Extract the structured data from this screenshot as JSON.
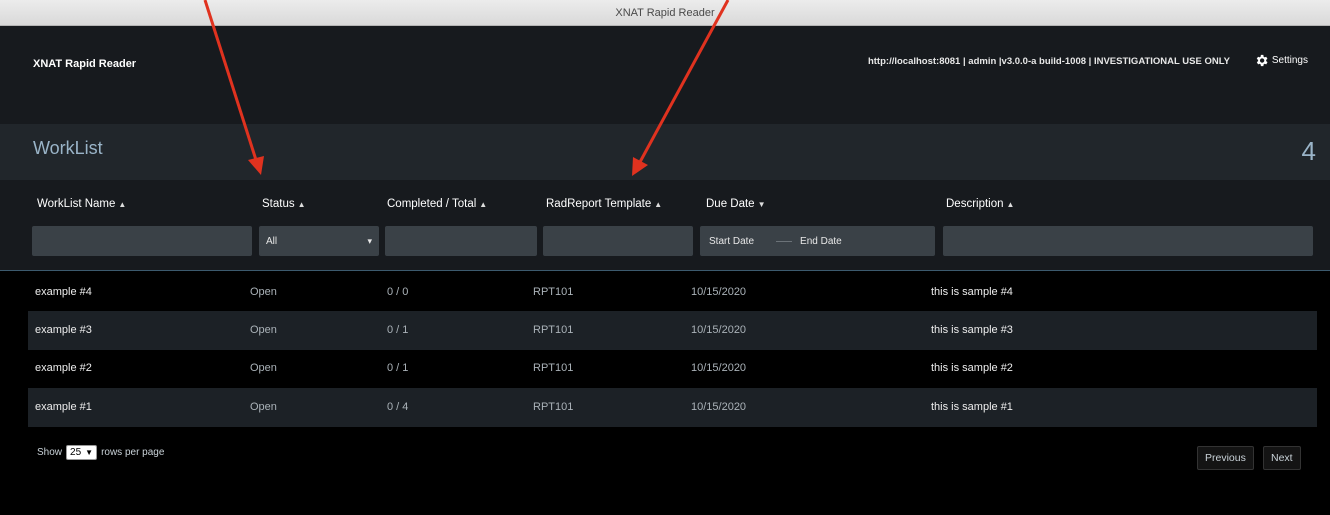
{
  "window": {
    "title": "XNAT Rapid Reader"
  },
  "header": {
    "app_name": "XNAT Rapid Reader",
    "server_info": "http://localhost:8081 | admin |v3.0.0-a build-1008 | INVESTIGATIONAL USE ONLY",
    "settings_label": "Settings"
  },
  "worklist": {
    "title": "WorkList",
    "count": "4"
  },
  "columns": {
    "name": "WorkList Name",
    "status": "Status",
    "completed": "Completed / Total",
    "template": "RadReport Template",
    "due": "Due Date",
    "description": "Description"
  },
  "filters": {
    "status_value": "All",
    "start_date": "Start Date",
    "end_date": "End Date"
  },
  "rows": [
    {
      "name": "example #4",
      "status": "Open",
      "completed": "0 / 0",
      "template": "RPT101",
      "due": "10/15/2020",
      "description": "this is sample #4"
    },
    {
      "name": "example #3",
      "status": "Open",
      "completed": "0 / 1",
      "template": "RPT101",
      "due": "10/15/2020",
      "description": "this is sample #3"
    },
    {
      "name": "example #2",
      "status": "Open",
      "completed": "0 / 1",
      "template": "RPT101",
      "due": "10/15/2020",
      "description": "this is sample #2"
    },
    {
      "name": "example #1",
      "status": "Open",
      "completed": "0 / 4",
      "template": "RPT101",
      "due": "10/15/2020",
      "description": "this is sample #1"
    }
  ],
  "pagination": {
    "show_label": "Show",
    "page_size": "25",
    "rows_label": "rows per page",
    "previous_label": "Previous",
    "next_label": "Next"
  },
  "colors": {
    "annotation_arrow": "#e0321f",
    "accent": "#9ab4c8"
  }
}
